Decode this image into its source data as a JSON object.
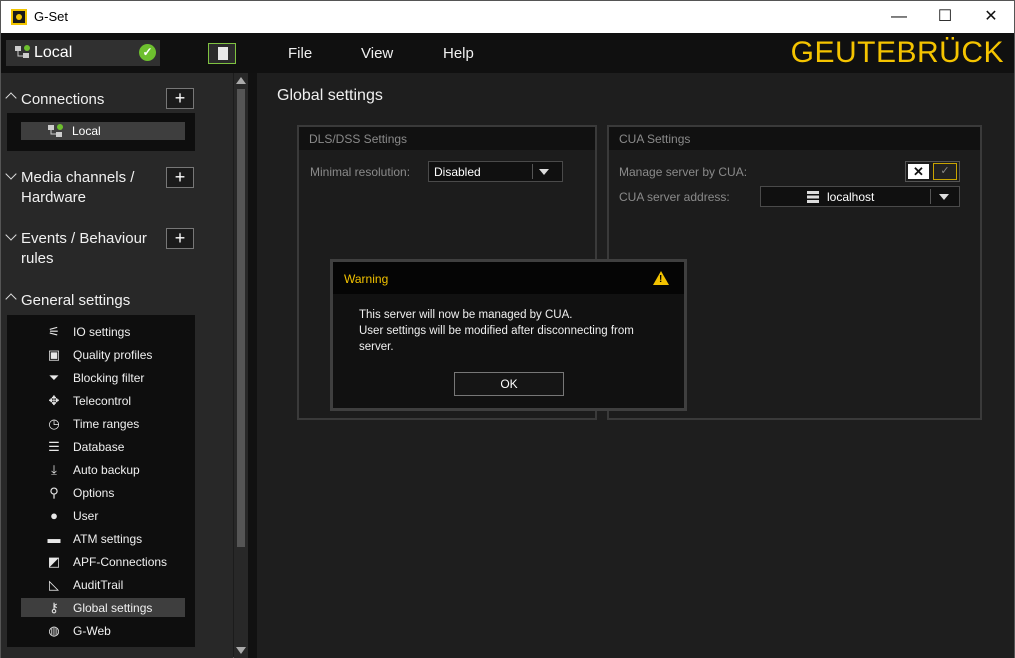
{
  "window": {
    "title": "G-Set",
    "minimize": "—",
    "maximize": "☐",
    "close": "✕"
  },
  "menubar": {
    "connection_label": "Local",
    "menus": [
      "File",
      "View",
      "Help"
    ],
    "brand": "GEUTEBRÜCK"
  },
  "sidebar": {
    "sections": [
      {
        "label": "Connections",
        "has_add": true
      },
      {
        "label": "Media channels / Hardware",
        "has_add": true
      },
      {
        "label": "Events / Behaviour rules",
        "has_add": true
      },
      {
        "label": "General settings",
        "has_add": false
      }
    ],
    "connections": [
      {
        "label": "Local"
      }
    ],
    "general_settings_items": [
      {
        "label": "IO settings",
        "icon": "io-icon"
      },
      {
        "label": "Quality profiles",
        "icon": "star-document-icon"
      },
      {
        "label": "Blocking filter",
        "icon": "filter-icon"
      },
      {
        "label": "Telecontrol",
        "icon": "move-arrows-icon"
      },
      {
        "label": "Time ranges",
        "icon": "clock-icon"
      },
      {
        "label": "Database",
        "icon": "database-icon"
      },
      {
        "label": "Auto backup",
        "icon": "download-icon"
      },
      {
        "label": "Options",
        "icon": "wrench-icon"
      },
      {
        "label": "User",
        "icon": "user-icon"
      },
      {
        "label": "ATM settings",
        "icon": "card-icon"
      },
      {
        "label": "APF-Connections",
        "icon": "apf-connection-icon"
      },
      {
        "label": "AuditTrail",
        "icon": "audit-chart-icon"
      },
      {
        "label": "Global settings",
        "icon": "key-icon",
        "selected": true
      },
      {
        "label": "G-Web",
        "icon": "globe-icon"
      }
    ]
  },
  "main": {
    "title": "Global settings",
    "dls_panel": {
      "title": "DLS/DSS Settings",
      "min_resolution_label": "Minimal resolution:",
      "min_resolution_value": "Disabled"
    },
    "cua_panel": {
      "title": "CUA Settings",
      "manage_label": "Manage server by CUA:",
      "toggle_off": "✕",
      "toggle_on": "✓",
      "address_label": "CUA server address:",
      "address_value": "localhost"
    }
  },
  "dialog": {
    "title": "Warning",
    "message_line1": "This server will now be managed by CUA.",
    "message_line2": "User settings will be modified after disconnecting from server.",
    "ok_label": "OK"
  },
  "colors": {
    "accent": "#f5c400",
    "ok_green": "#6dbf2e",
    "highlight": "#7fc241"
  }
}
